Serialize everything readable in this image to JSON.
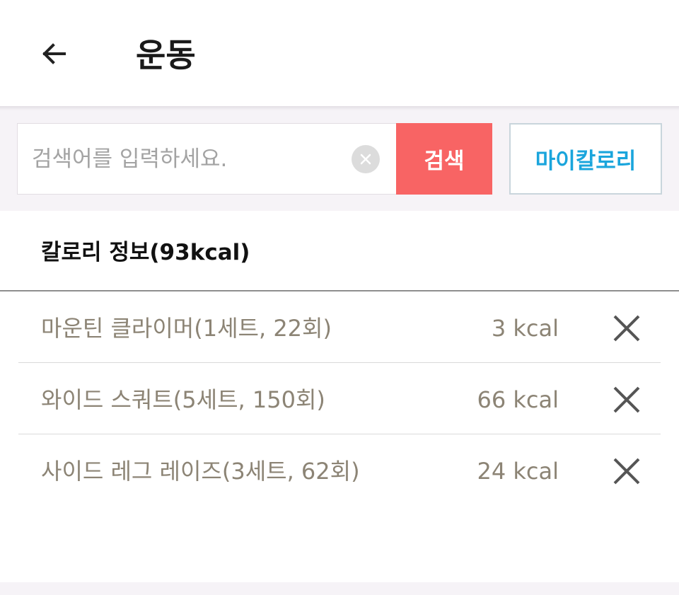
{
  "header": {
    "title": "운동",
    "back_icon": "arrow-left-icon"
  },
  "search": {
    "placeholder": "검색어를 입력하세요.",
    "value": "",
    "clear_icon": "clear-circle-icon",
    "search_label": "검색",
    "my_calorie_label": "마이칼로리"
  },
  "calorie_info": {
    "title": "칼로리 정보(93kcal)",
    "items": [
      {
        "name": "마운틴 클라이머(1세트, 22회)",
        "kcal": "3 kcal"
      },
      {
        "name": "와이드 스쿼트(5세트, 150회)",
        "kcal": "66 kcal"
      },
      {
        "name": "사이드 레그 레이즈(3세트, 62회)",
        "kcal": "24 kcal"
      }
    ]
  },
  "colors": {
    "search_button": "#f86464",
    "my_calorie_text": "#1aa5dc",
    "item_text": "#8c8475",
    "band_background": "#f6f3f7"
  }
}
